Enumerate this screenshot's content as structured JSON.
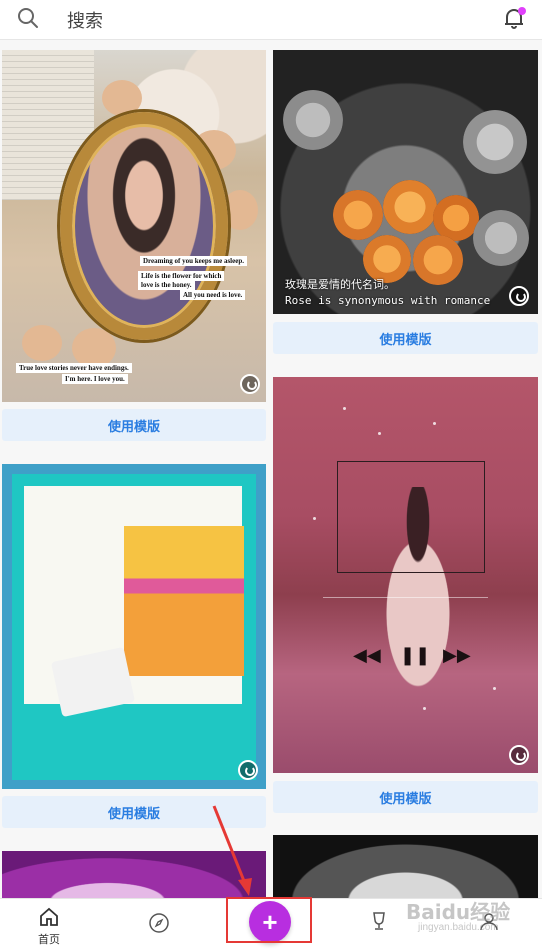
{
  "header": {
    "search_label": "搜索",
    "icons": [
      "search-icon",
      "bell-icon"
    ],
    "notification_dot_color": "#e040fb"
  },
  "feed": {
    "use_template_label": "使用模版",
    "card1": {
      "captions": [
        "Dreaming of you keeps me asleep.",
        "Life is the flower for which",
        "love is the honey.",
        "All you need is love.",
        "True love stories never have endings.",
        "I'm here. I love you."
      ]
    },
    "card2": {
      "line1": "玫瑰是爱情的代名词。",
      "line2": "Rose is synonymous with romance"
    }
  },
  "bottom_nav": {
    "home_label": "首页",
    "icons": [
      "home-icon",
      "compass-icon",
      "plus-icon",
      "trophy-icon",
      "profile-icon"
    ]
  },
  "overlay": {
    "watermark": "Baidu经验",
    "watermark_sub": "jingyan.baidu.com",
    "highlight_color": "#e53935"
  }
}
